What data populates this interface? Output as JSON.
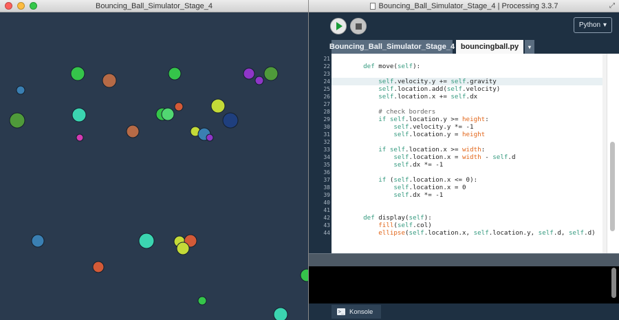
{
  "sketch_window": {
    "title": "Bouncing_Ball_Simulator_Stage_4",
    "background_color": "#2a3a4e"
  },
  "ide_window": {
    "title": "Bouncing_Ball_Simulator_Stage_4 | Processing 3.3.7",
    "mode_label": "Python",
    "tabs": [
      {
        "label": "Bouncing_Ball_Simulator_Stage_4",
        "active": false
      },
      {
        "label": "bouncingball.py",
        "active": true
      }
    ],
    "tab_menu_glyph": "▾",
    "console_tab_label": "Konsole",
    "console_icon_glyph": ">_",
    "line_numbers": [
      "21",
      "22",
      "23",
      "24",
      "25",
      "26",
      "27",
      "28",
      "29",
      "30",
      "31",
      "32",
      "33",
      "34",
      "35",
      "36",
      "37",
      "38",
      "39",
      "40",
      "41",
      "42",
      "43",
      "44"
    ],
    "highlighted_line": "24",
    "code_lines": [
      "",
      "    def move(self):",
      "",
      "        self.velocity.y += self.gravity",
      "        self.location.add(self.velocity)",
      "        self.location.x += self.dx",
      "",
      "        # check borders",
      "        if self.location.y >= height:",
      "            self.velocity.y *= -1",
      "            self.location.y = height",
      "",
      "        if self.location.x >= width:",
      "            self.location.x = width - self.d",
      "            self.dx *= -1",
      "",
      "        if (self.location.x <= 0):",
      "            self.location.x = 0",
      "            self.dx *= -1",
      "",
      "",
      "    def display(self):",
      "        fill(self.col)",
      "        ellipse(self.location.x, self.location.y, self.d, self.d)"
    ]
  }
}
